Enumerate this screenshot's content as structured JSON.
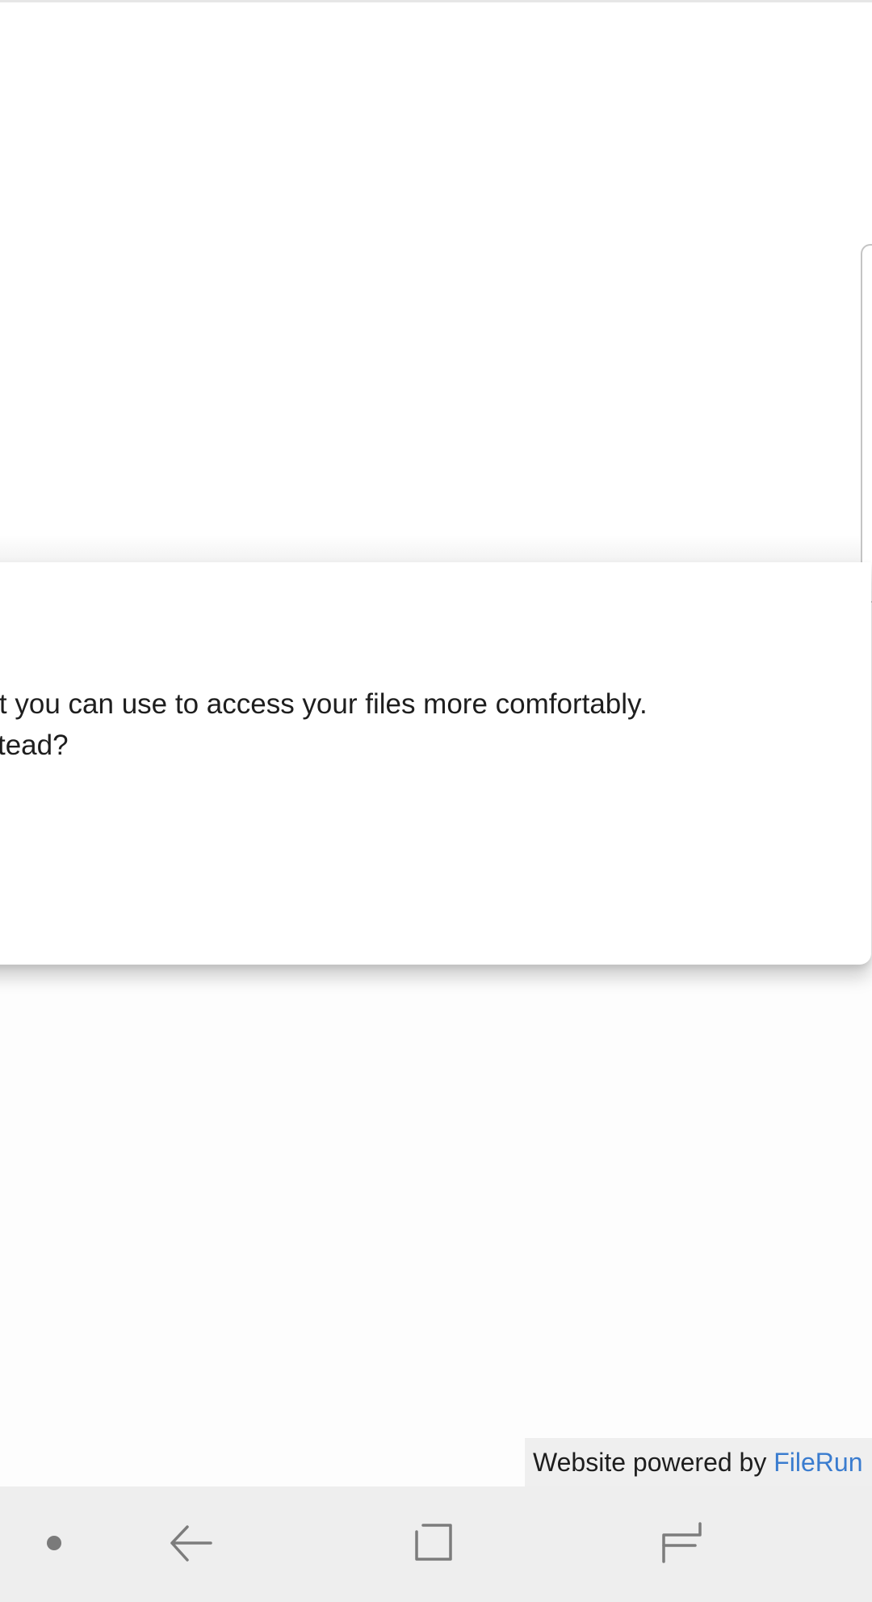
{
  "dialog": {
    "message_lines": [
      "hat you can use to access your files more comfortably.",
      "nstead?"
    ]
  },
  "footer": {
    "powered_prefix": "Website powered by ",
    "powered_brand": "FileRun",
    "brand_color": "#3a7ccf"
  },
  "navigation_bar": {
    "buttons": [
      "dot-icon",
      "back-icon",
      "home-icon",
      "recents-icon"
    ]
  }
}
